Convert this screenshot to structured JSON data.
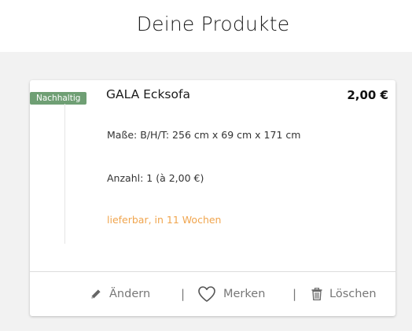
{
  "page": {
    "title": "Deine Produkte"
  },
  "product": {
    "badge": "Nachhaltig",
    "name": "GALA Ecksofa",
    "price": "2,00 €",
    "dimensions": "Maße: B/H/T: 256 cm x 69 cm x 171 cm",
    "quantity": "Anzahl: 1 (à 2,00 €)",
    "availability": "lieferbar, in 11 Wochen"
  },
  "actions": {
    "edit_label": "Ändern",
    "edit_icon": "pencil-icon",
    "separator": "|",
    "save_label": "Merken",
    "save_icon": "heart-icon",
    "delete_label": "Löschen",
    "delete_icon": "trash-icon"
  },
  "colors": {
    "badge_background": "#6f9f74",
    "availability": "#f0a54e",
    "action_text": "#777777",
    "page_background": "#f2f2f2"
  }
}
